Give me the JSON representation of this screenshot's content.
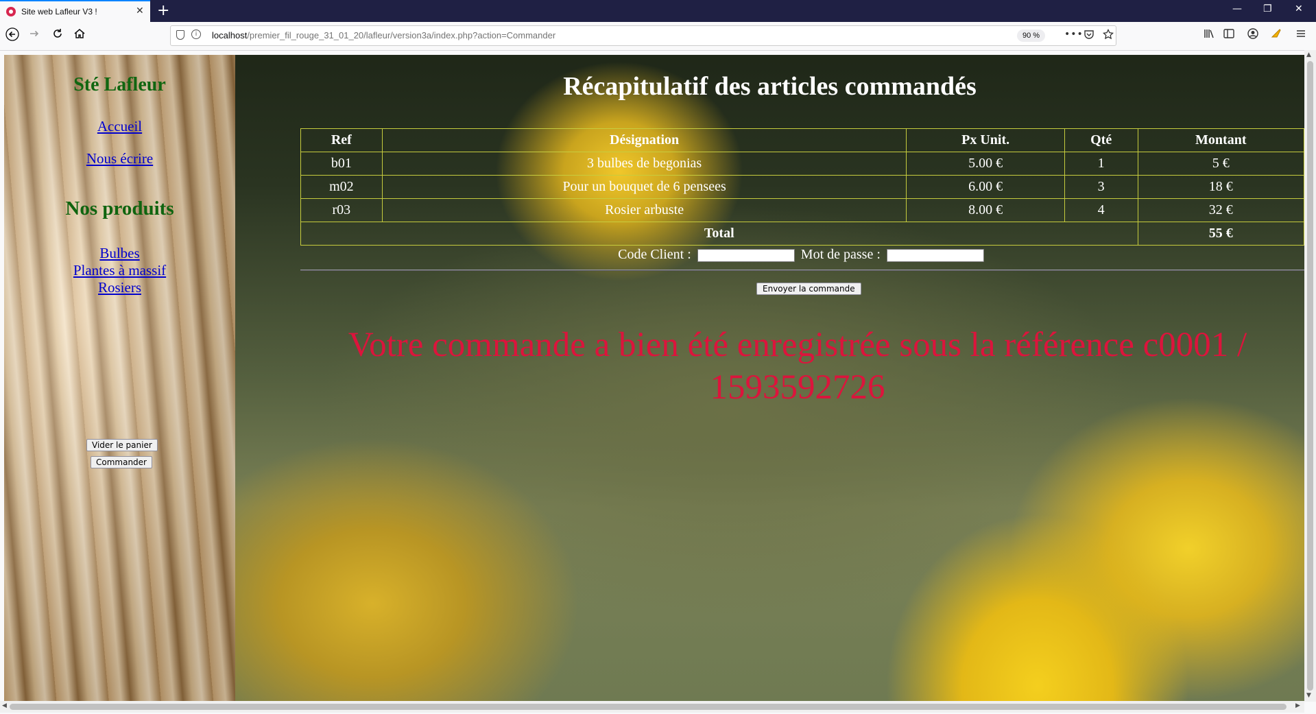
{
  "browser": {
    "tab_title": "Site web Lafleur V3 !",
    "tab_close": "✕",
    "new_tab": "+",
    "url_host": "localhost",
    "url_path": "/premier_fil_rouge_31_01_20/lafleur/version3a/index.php?action=Commander",
    "zoom": "90 %",
    "win_minimize": "—",
    "win_restore": "❐",
    "win_close": "✕"
  },
  "sidebar": {
    "title": "Sté Lafleur",
    "nav": [
      {
        "label": "Accueil"
      },
      {
        "label": "Nous écrire"
      }
    ],
    "products_heading": "Nos produits",
    "products": [
      {
        "label": "Bulbes"
      },
      {
        "label": "Plantes à massif"
      },
      {
        "label": "Rosiers"
      }
    ],
    "empty_cart_button": "Vider le panier",
    "order_button": "Commander"
  },
  "main": {
    "heading": "Récapitulatif des articles commandés",
    "table": {
      "headers": [
        "Ref",
        "Désignation",
        "Px Unit.",
        "Qté",
        "Montant"
      ],
      "rows": [
        {
          "ref": "b01",
          "designation": "3 bulbes de begonias",
          "price": "5.00 €",
          "qty": "1",
          "amount": "5 €"
        },
        {
          "ref": "m02",
          "designation": "Pour un bouquet de 6 pensees",
          "price": "6.00 €",
          "qty": "3",
          "amount": "18 €"
        },
        {
          "ref": "r03",
          "designation": "Rosier arbuste",
          "price": "8.00 €",
          "qty": "4",
          "amount": "32 €"
        }
      ],
      "total_label": "Total",
      "total_value": "55 €"
    },
    "client_code_label": "Code Client :",
    "client_code_value": "",
    "password_label": "Mot de passe :",
    "password_value": "",
    "send_button": "Envoyer la commande",
    "confirmation": "Votre commande a bien été enregistrée sous la référence c0001 / 1593592726"
  },
  "colors": {
    "sidebar_title": "#106610",
    "link": "#0000cc",
    "confirmation": "#dc143c",
    "table_border": "#c7cd3e",
    "tab_accent": "#0a84ff"
  },
  "icons": [
    "back-arrow-icon",
    "forward-arrow-icon",
    "reload-icon",
    "home-icon",
    "shield-icon",
    "info-icon",
    "more-icon",
    "pocket-icon",
    "star-icon",
    "library-icon",
    "sidebar-icon",
    "account-icon",
    "extension-icon",
    "menu-icon"
  ]
}
